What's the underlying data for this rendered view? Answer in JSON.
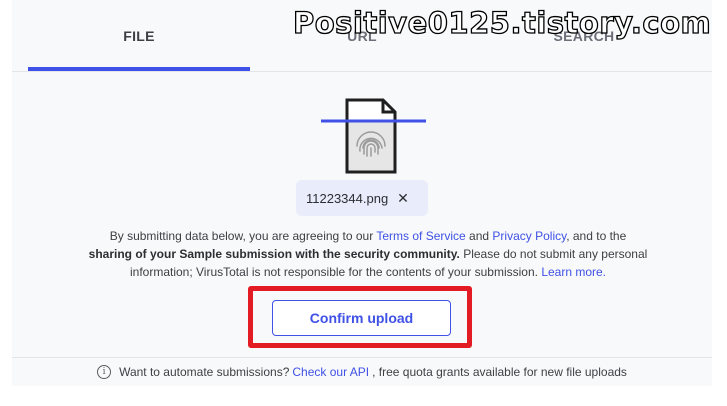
{
  "tabs": [
    {
      "label": "FILE",
      "active": true
    },
    {
      "label": "URL",
      "active": false
    },
    {
      "label": "SEARCH",
      "active": false
    }
  ],
  "file": {
    "name": "11223344.png",
    "remove_icon": "close-icon",
    "icon": "fingerprint-file-icon"
  },
  "terms": {
    "part1": "By submitting data below, you are agreeing to our ",
    "tos_link": "Terms of Service",
    "and": " and ",
    "privacy_link": "Privacy Policy",
    "part2": ", and to the ",
    "bold": "sharing of your Sample submission with the security community.",
    "part3": " Please do not submit any personal information; VirusTotal is not responsible for the contents of your submission. ",
    "learn_link": "Learn more."
  },
  "confirm_button": "Confirm upload",
  "footer": {
    "text1": "Want to automate submissions?",
    "api_link": "Check our API",
    "text2": ", free quota grants available for new file uploads"
  },
  "watermark": "Positive0125.tistory.com",
  "colors": {
    "accent": "#3f51e6",
    "highlight": "#e31b23",
    "chip_bg": "#e8ecfb"
  }
}
